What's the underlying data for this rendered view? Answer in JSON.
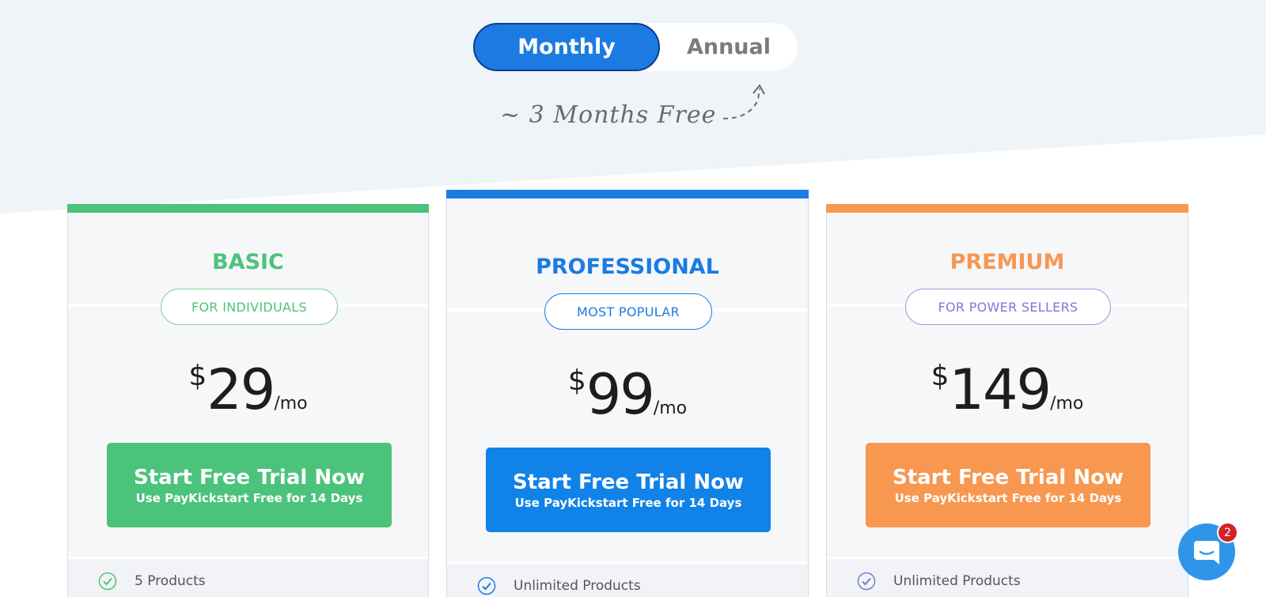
{
  "billing_toggle": {
    "monthly_label": "Monthly",
    "annual_label": "Annual",
    "selected": "Monthly"
  },
  "promo_note": "~ 3 Months Free",
  "plans": [
    {
      "name": "BASIC",
      "tagline": "FOR INDIVIDUALS",
      "currency": "$",
      "price": "29",
      "period": "/mo",
      "cta_main": "Start Free Trial Now",
      "cta_sub": "Use PayKickstart Free for 14 Days",
      "features": [
        "5 Products"
      ],
      "accent": "#4bc37b"
    },
    {
      "name": "PROFESSIONAL",
      "tagline": "MOST POPULAR",
      "currency": "$",
      "price": "99",
      "period": "/mo",
      "cta_main": "Start Free Trial Now",
      "cta_sub": "Use PayKickstart Free for 14 Days",
      "features": [
        "Unlimited Products"
      ],
      "accent": "#1b7be3"
    },
    {
      "name": "PREMIUM",
      "tagline": "FOR POWER SELLERS",
      "currency": "$",
      "price": "149",
      "period": "/mo",
      "cta_main": "Start Free Trial Now",
      "cta_sub": "Use PayKickstart Free for 14 Days",
      "features": [
        "Unlimited Products"
      ],
      "accent": "#f79750"
    }
  ],
  "chat": {
    "icon": "chat-bubble-icon",
    "badge_count": "2"
  },
  "colors": {
    "background_wedge": "#eef4f8",
    "card_background": "#f6f7f9",
    "chat_button": "#2f95e8",
    "badge": "#d0242b",
    "premium_tagline_text": "#7a78d8"
  }
}
